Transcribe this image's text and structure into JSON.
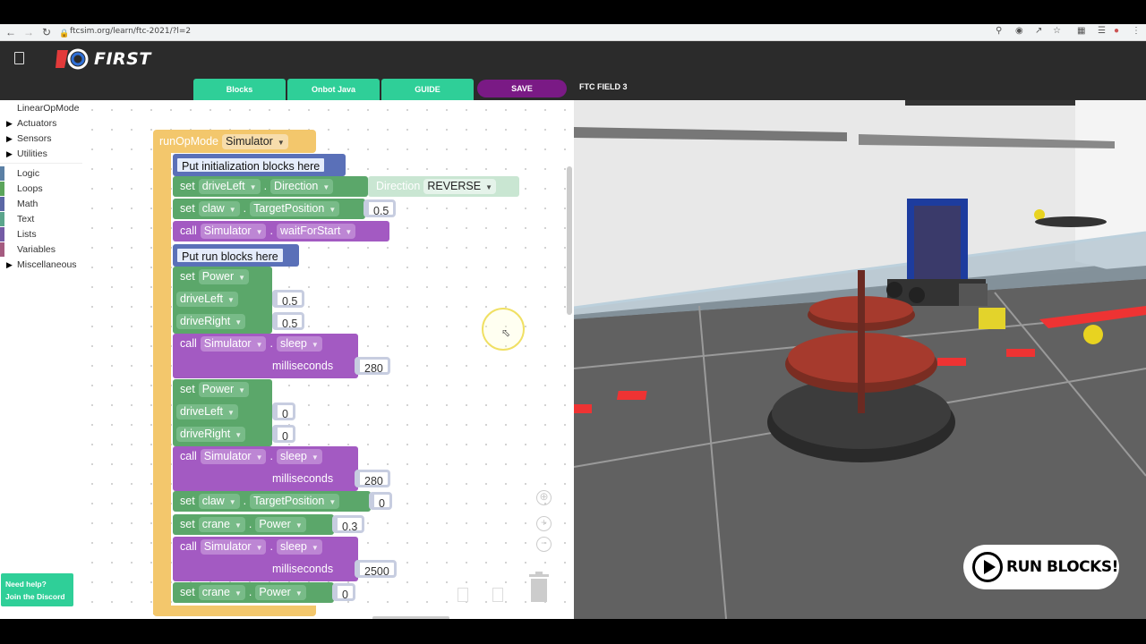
{
  "browser": {
    "url": "ftcsim.org/learn/ftc-2021/?l=2"
  },
  "header": {
    "logo_text": "FIRST",
    "tabs": [
      {
        "label": "Blocks"
      },
      {
        "label": "Onbot Java"
      },
      {
        "label": "GUIDE"
      }
    ],
    "save_label": "SAVE",
    "field_label": "FTC FIELD 3"
  },
  "toolbox": {
    "items": [
      {
        "label": "LinearOpMode",
        "expandable": false
      },
      {
        "label": "Actuators",
        "expandable": true
      },
      {
        "label": "Sensors",
        "expandable": true
      },
      {
        "label": "Utilities",
        "expandable": true
      },
      {
        "label": "Logic",
        "expandable": false
      },
      {
        "label": "Loops",
        "expandable": false
      },
      {
        "label": "Math",
        "expandable": false
      },
      {
        "label": "Text",
        "expandable": false
      },
      {
        "label": "Lists",
        "expandable": false
      },
      {
        "label": "Variables",
        "expandable": false
      },
      {
        "label": "Miscellaneous",
        "expandable": true
      }
    ]
  },
  "blocks": {
    "opmode_label": "runOpMode",
    "opmode_target": "Simulator",
    "init_comment": "Put initialization blocks here",
    "run_comment": "Put run blocks here",
    "kw_set": "set",
    "kw_call": "call",
    "kw_milliseconds": "milliseconds",
    "dot": ".",
    "drive_left": "driveLeft",
    "drive_right": "driveRight",
    "direction": "Direction",
    "direction_value": "REVERSE",
    "claw": "claw",
    "target_position": "TargetPosition",
    "simulator": "Simulator",
    "wait_for_start": "waitForStart",
    "power": "Power",
    "sleep": "sleep",
    "crane": "crane",
    "v_claw_init": "0.5",
    "v_left_1": "0.5",
    "v_right_1": "0.5",
    "v_ms_1": "280",
    "v_left_2": "0",
    "v_right_2": "0",
    "v_ms_2": "280",
    "v_claw_2": "0",
    "v_crane_1": "0.3",
    "v_ms_3": "2500",
    "v_crane_2": "0"
  },
  "help": {
    "line1": "Need help?",
    "line2": "Join the Discord"
  },
  "simulator": {
    "run_label": "RUN BLOCKS!"
  }
}
